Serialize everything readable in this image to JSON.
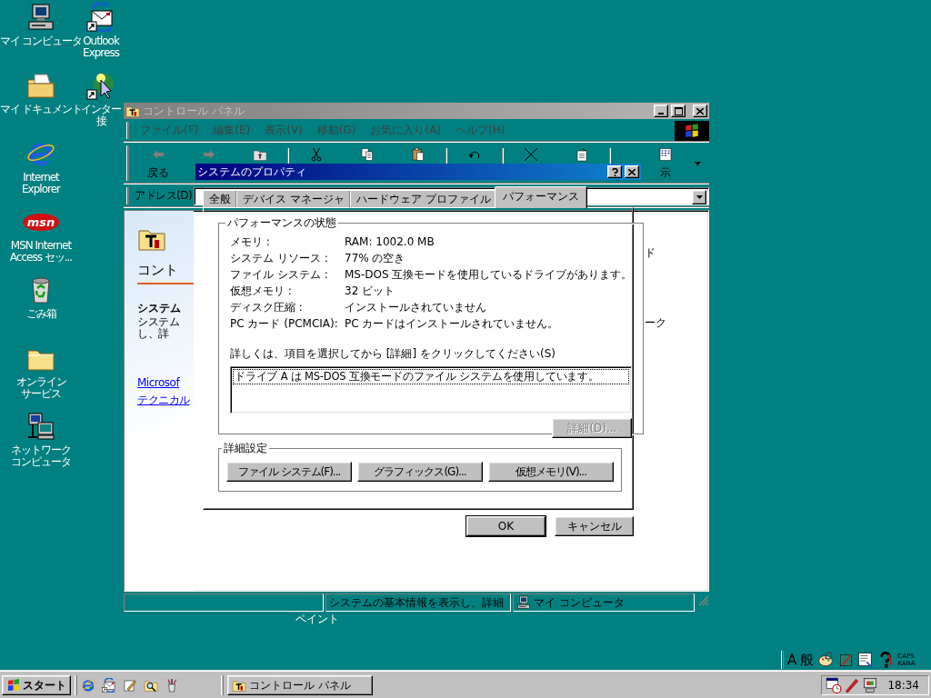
{
  "desktop_icons": [
    {
      "kind": "computer",
      "lines": [
        "マイ コンピュータ"
      ]
    },
    {
      "kind": "documents",
      "lines": [
        "マイ ドキュメント"
      ]
    },
    {
      "kind": "browser",
      "lines": [
        "Internet",
        "Explorer"
      ]
    },
    {
      "kind": "msn",
      "logo": "msn",
      "lines": [
        "MSN Internet",
        "Access セッ..."
      ]
    },
    {
      "kind": "recycle",
      "lines": [
        "ごみ箱"
      ]
    },
    {
      "kind": "folder",
      "lines": [
        "オンライン",
        "サービス"
      ]
    },
    {
      "kind": "network",
      "lines": [
        "ネットワーク",
        "コンピュータ"
      ]
    },
    {
      "kind": "mail",
      "lines": [
        "Outlook",
        "Express"
      ]
    },
    {
      "kind": "connect",
      "lines": [
        "インター",
        "接"
      ]
    }
  ],
  "hidden_icon_label": "ペイント",
  "explorer_window": {
    "title": "コントロール パネル",
    "active": false,
    "menu": [
      "ファイル(F)",
      "編集(E)",
      "表示(V)",
      "移動(G)",
      "お気に入り(A)",
      "ヘルプ(H)"
    ],
    "toolbar": [
      {
        "kind": "back",
        "label": "戻る"
      },
      {
        "kind": "forward"
      },
      {
        "kind": "up"
      },
      {
        "kind": "separator"
      },
      {
        "kind": "cut"
      },
      {
        "kind": "copy"
      },
      {
        "kind": "paste"
      },
      {
        "kind": "separator"
      },
      {
        "kind": "undo"
      },
      {
        "kind": "separator"
      },
      {
        "kind": "delete"
      },
      {
        "kind": "properties"
      },
      {
        "kind": "separator"
      },
      {
        "kind": "views",
        "label": "示"
      }
    ],
    "address_label": "アドレス(D)",
    "content": {
      "heading": "コント",
      "section_title": "システム",
      "section_lines": [
        "システム",
        "し、詳"
      ],
      "links": [
        "Microsof",
        "テクニカル"
      ],
      "right_fragments": [
        "ド",
        "ーク"
      ]
    },
    "status_bar": {
      "description": "システムの基本情報を表示し、詳細",
      "zone": "マイ コンピュータ"
    }
  },
  "dialog": {
    "title": "システムのプロパティ",
    "active": true,
    "tabs": [
      {
        "label": "全般",
        "selected": false
      },
      {
        "label": "デバイス マネージャ",
        "selected": false
      },
      {
        "label": "ハードウェア プロファイル",
        "selected": false
      },
      {
        "label": "パフォーマンス",
        "selected": true
      }
    ],
    "status_group": {
      "title": "パフォーマンスの状態",
      "rows": [
        {
          "label": "メモリ :",
          "value": "RAM: 1002.0 MB"
        },
        {
          "label": "システム リソース :",
          "value": "77% の空き"
        },
        {
          "label": "ファイル システム :",
          "value": "MS-DOS 互換モードを使用しているドライブがあります。"
        },
        {
          "label": "仮想メモリ :",
          "value": "32 ビット"
        },
        {
          "label": "ディスク圧縮 :",
          "value": "インストールされていません"
        },
        {
          "label": "PC カード (PCMCIA):",
          "value": "PC カードはインストールされていません。"
        }
      ]
    },
    "details_prompt": "詳しくは、項目を選択してから [詳細] をクリックしてください(S)",
    "list_items": [
      {
        "text": "ドライブ A は MS-DOS 互換モードのファイル システムを使用しています。",
        "selected": true
      }
    ],
    "details_button": {
      "label": "詳細(D)...",
      "disabled": true
    },
    "advanced_group": {
      "title": "詳細設定",
      "buttons": [
        "ファイル システム(F)...",
        "グラフィックス(G)...",
        "仮想メモリ(V)..."
      ]
    },
    "buttons": [
      {
        "label": "OK",
        "default": true
      },
      {
        "label": "キャンセル",
        "default": false
      }
    ]
  },
  "language_bar": {
    "mode": "A",
    "input": "般",
    "caps": "CAPS",
    "kana": "KANA"
  },
  "taskbar": {
    "start": "スタート",
    "tasks": [
      {
        "title": "コントロール パネル",
        "selected": false
      }
    ],
    "clock": "18:34"
  }
}
